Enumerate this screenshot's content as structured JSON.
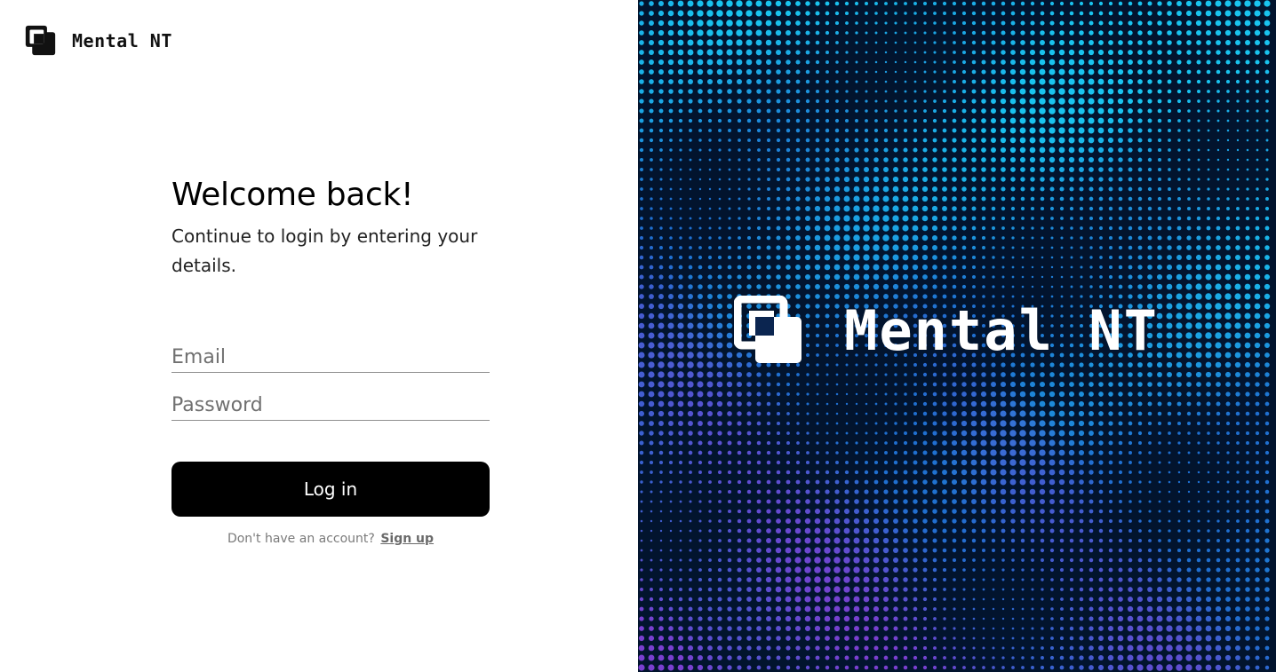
{
  "brand": {
    "name": "Mental NT"
  },
  "login": {
    "title": "Welcome back!",
    "subtitle": "Continue to login by entering your details.",
    "email_placeholder": "Email",
    "email_value": "",
    "password_placeholder": "Password",
    "password_value": "",
    "submit_label": "Log in",
    "signup_prompt": "Don't have an account?",
    "signup_link": "Sign up"
  },
  "hero": {
    "brand_name": "Mental NT",
    "icon": "overlapping-squares-logo-icon",
    "background": "dotted-wave-pattern"
  },
  "colors": {
    "button_bg": "#000000",
    "hero_bg": "#02142e",
    "dot_cyan": "#19c4ef",
    "dot_blue": "#1f6fd0",
    "dot_purple": "#7a3fd0"
  }
}
